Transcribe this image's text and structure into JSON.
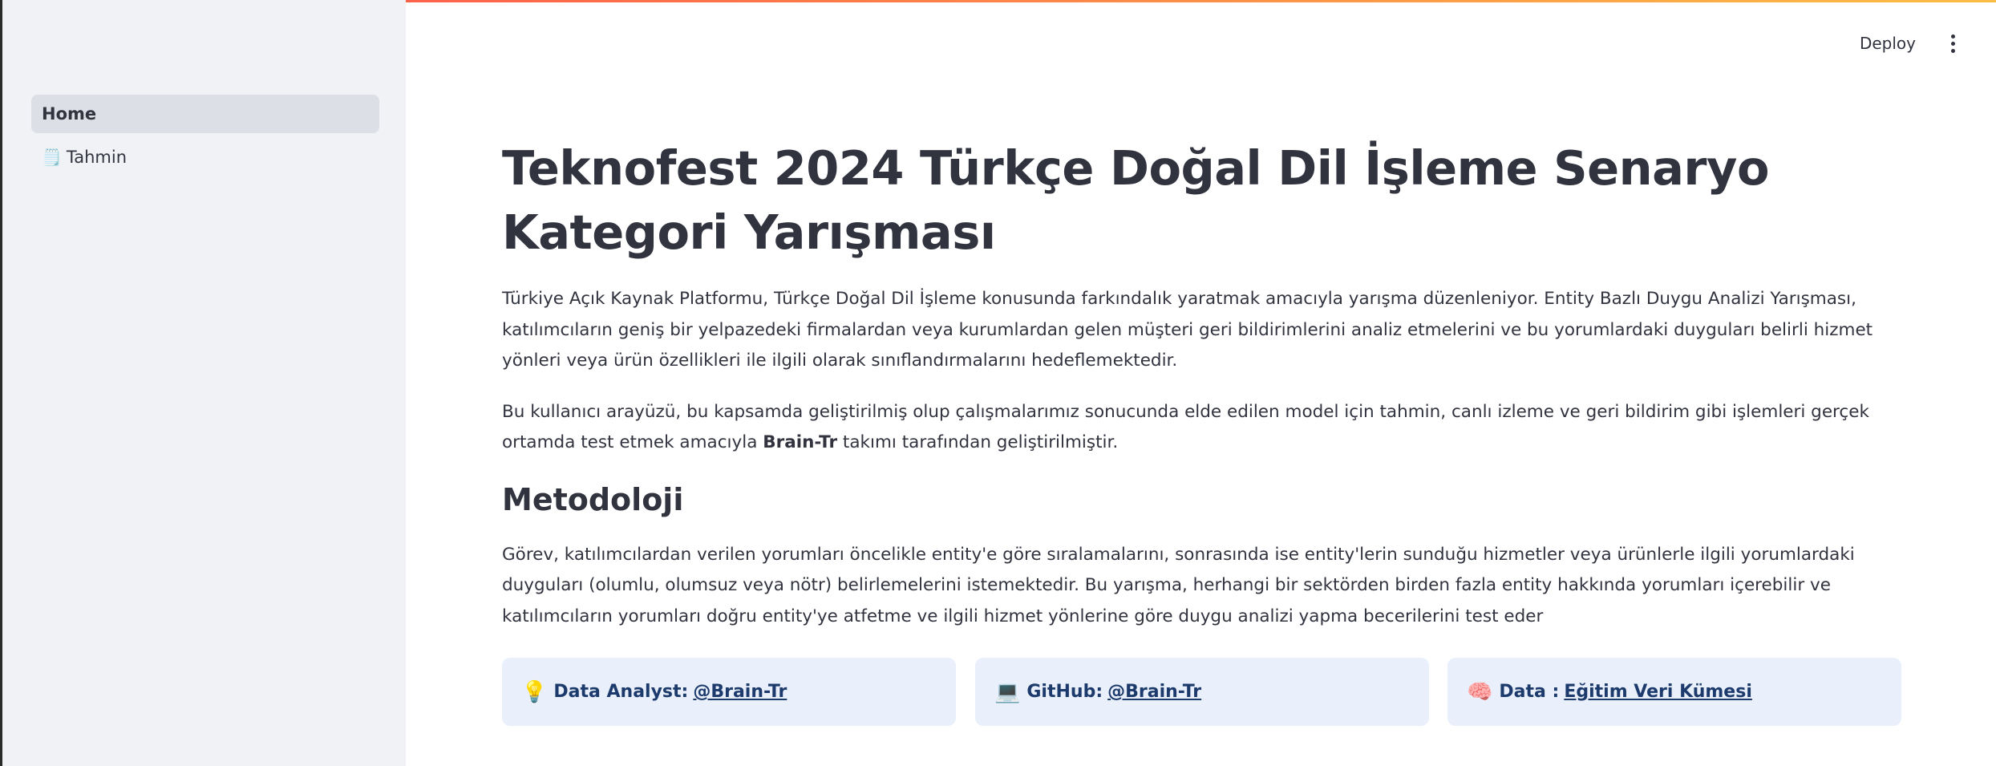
{
  "sidebar": {
    "items": [
      {
        "label": "Home",
        "icon": ""
      },
      {
        "label": "Tahmin",
        "icon": "🗒️"
      }
    ]
  },
  "header": {
    "deploy_label": "Deploy",
    "menu_icon": "more-vertical-icon"
  },
  "main": {
    "title": "Teknofest 2024 Türkçe Doğal Dil İşleme Senaryo Kategori Yarışması",
    "intro": "Türkiye Açık Kaynak Platformu, Türkçe Doğal Dil İşleme konusunda farkındalık yaratmak amacıyla yarışma düzenleniyor. Entity Bazlı Duygu Analizi Yarışması, katılımcıların geniş bir yelpazedeki firmalardan veya kurumlardan gelen müşteri geri bildirimlerini analiz etmelerini ve bu yorumlardaki duyguları belirli hizmet yönleri veya ürün özellikleri ile ilgili olarak sınıflandırmalarını hedeflemektedir.",
    "ui_text_before": "Bu kullanıcı arayüzü, bu kapsamda geliştirilmiş olup çalışmalarımız sonucunda elde edilen model için tahmin, canlı izleme ve geri bildirim gibi işlemleri gerçek ortamda test etmek amacıyla ",
    "ui_text_bold": "Brain-Tr",
    "ui_text_after": " takımı tarafından geliştirilmiştir.",
    "methodology_heading": "Metodoloji",
    "methodology_text": "Görev, katılımcılardan verilen yorumları öncelikle entity'e göre sıralamalarını, sonrasında ise entity'lerin sunduğu hizmetler veya ürünlerle ilgili yorumlardaki duyguları (olumlu, olumsuz veya nötr) belirlemelerini istemektedir. Bu yarışma, herhangi bir sektörden birden fazla entity hakkında yorumları içerebilir ve katılımcıların yorumları doğru entity'ye atfetme ve ilgili hizmet yönlerine göre duygu analizi yapma becerilerini test eder"
  },
  "cards": [
    {
      "emoji": "💡",
      "label": "Data Analyst:",
      "link": "@Brain-Tr"
    },
    {
      "emoji": "💻",
      "label": "GitHub:",
      "link": "@Brain-Tr"
    },
    {
      "emoji": "🧠",
      "label": "Data :",
      "link": "Eğitim Veri Kümesi"
    }
  ],
  "colors": {
    "sidebar_bg": "#f0f2f6",
    "card_bg": "#e9f0fb",
    "card_text": "#1c3a6b",
    "text": "#31333f"
  }
}
